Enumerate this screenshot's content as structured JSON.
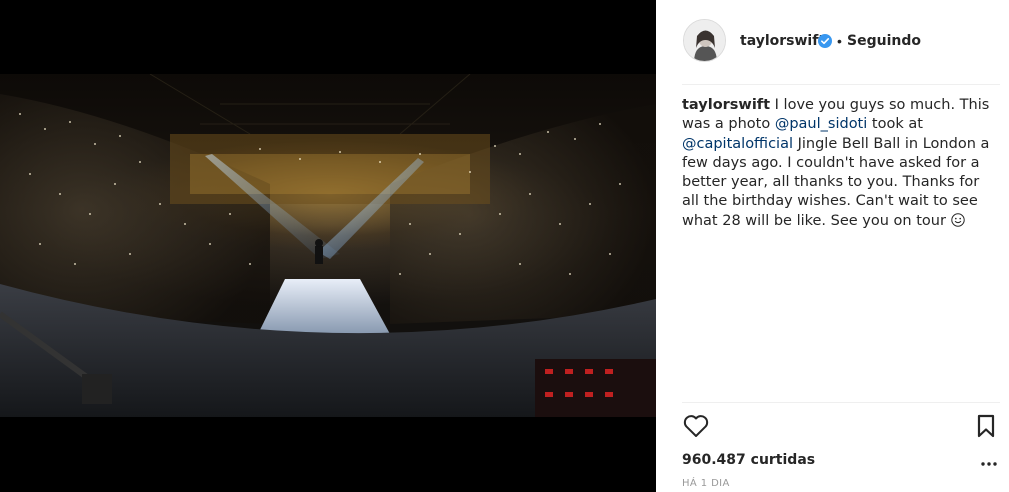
{
  "post": {
    "username": "taylorswift",
    "follow_separator": "•",
    "follow_status": "Seguindo",
    "caption": {
      "user": "taylorswift",
      "text_1": " I love you guys so much. This was a photo ",
      "mention_1": "@paul_sidoti",
      "text_2": " took at ",
      "mention_2": "@capitalofficial",
      "text_3": " Jingle Bell Ball in London a few days ago. I couldn't have asked for a better year, all thanks to you. Thanks for all the birthday wishes. Can't wait to see what 28 will be like. See you on tour "
    },
    "likes": "960.487 curtidas",
    "timestamp": "HÁ 1 DIA"
  },
  "icons": {
    "verified": "verified-badge-icon",
    "like": "heart-icon",
    "save": "bookmark-icon",
    "more": "more-options-icon",
    "emoji": "smiling-face-emoji"
  },
  "colors": {
    "text": "#262626",
    "mention": "#003569",
    "verified": "#3897f0",
    "muted": "#999999",
    "divider": "#efefef"
  }
}
